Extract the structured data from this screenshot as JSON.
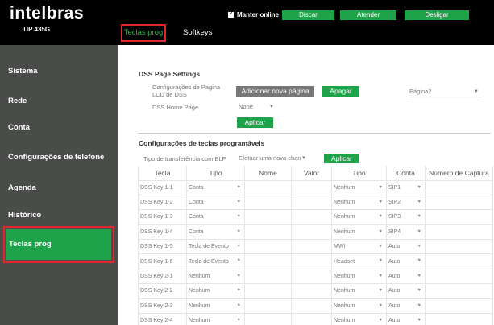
{
  "header": {
    "logo": "intelbras",
    "model": "TIP 435G",
    "tabs": [
      {
        "label": "Teclas prog",
        "active": true
      },
      {
        "label": "Softkeys",
        "active": false
      }
    ],
    "keep_online": {
      "label": "Manter online",
      "checked": true
    },
    "buttons": [
      "Discar",
      "Atender",
      "Desligar"
    ]
  },
  "sidebar": {
    "items": [
      {
        "label": "Sistema"
      },
      {
        "label": "Rede"
      },
      {
        "label": "Conta"
      },
      {
        "label": "Configurações de telefone"
      },
      {
        "label": "Agenda"
      },
      {
        "label": "Histórico"
      },
      {
        "label": "Teclas prog",
        "active": true
      }
    ]
  },
  "dss": {
    "title": "DSS Page Settings",
    "lcd_label": "Configurações de Pagina LCD de DSS",
    "add_page": "Adicionar nova página",
    "delete": "Apagar",
    "page_select": "Página2",
    "home_label": "DSS Home Page",
    "home_value": "None",
    "apply": "Aplicar"
  },
  "prog": {
    "title": "Configurações de teclas programáveis",
    "transfer_label": "Tipo de transferência com BLF",
    "transfer_value": "Efetuar uma nova chan",
    "apply": "Aplicar",
    "columns": [
      "Tecla",
      "Tipo",
      "Nome",
      "Valor",
      "Tipo",
      "Conta",
      "Número de Captura"
    ],
    "rows": [
      {
        "key": "DSS Key 1-1",
        "type": "Conta",
        "name": "",
        "value": "",
        "subtype": "Nenhum",
        "account": "SIP1",
        "pickup": ""
      },
      {
        "key": "DSS Key 1-2",
        "type": "Conta",
        "name": "",
        "value": "",
        "subtype": "Nenhum",
        "account": "SIP2",
        "pickup": ""
      },
      {
        "key": "DSS Key 1-3",
        "type": "Conta",
        "name": "",
        "value": "",
        "subtype": "Nenhum",
        "account": "SIP3",
        "pickup": ""
      },
      {
        "key": "DSS Key 1-4",
        "type": "Conta",
        "name": "",
        "value": "",
        "subtype": "Nenhum",
        "account": "SIP4",
        "pickup": ""
      },
      {
        "key": "DSS Key 1-5",
        "type": "Tecla de Evento",
        "name": "",
        "value": "",
        "subtype": "MWI",
        "account": "Auto",
        "pickup": ""
      },
      {
        "key": "DSS Key 1-6",
        "type": "Tecla de Evento",
        "name": "",
        "value": "",
        "subtype": "Headset",
        "account": "Auto",
        "pickup": ""
      },
      {
        "key": "DSS Key 2-1",
        "type": "Nenhum",
        "name": "",
        "value": "",
        "subtype": "Nenhum",
        "account": "Auto",
        "pickup": ""
      },
      {
        "key": "DSS Key 2-2",
        "type": "Nenhum",
        "name": "",
        "value": "",
        "subtype": "Nenhum",
        "account": "Auto",
        "pickup": ""
      },
      {
        "key": "DSS Key 2-3",
        "type": "Nenhum",
        "name": "",
        "value": "",
        "subtype": "Nenhum",
        "account": "Auto",
        "pickup": ""
      },
      {
        "key": "DSS Key 2-4",
        "type": "Nenhum",
        "name": "",
        "value": "",
        "subtype": "Nenhum",
        "account": "Auto",
        "pickup": ""
      }
    ]
  },
  "colors": {
    "accent": "#1ea34a",
    "highlight": "#e3262b",
    "sidebar": "#4a4c4a",
    "header": "#000000"
  }
}
